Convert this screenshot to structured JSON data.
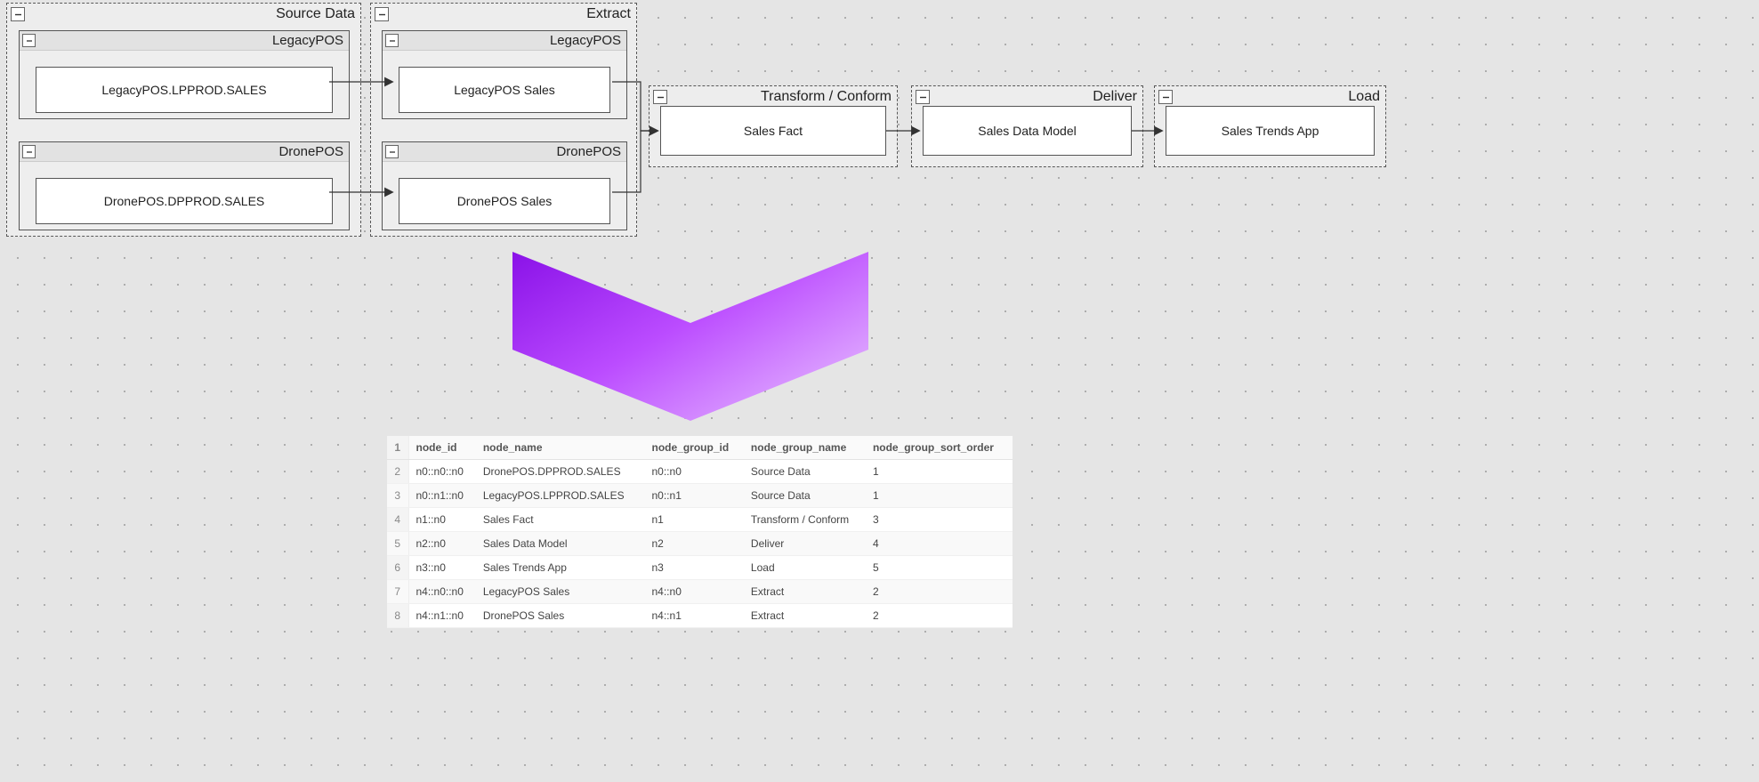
{
  "groups": {
    "source": {
      "title": "Source Data",
      "sub1": {
        "title": "LegacyPOS",
        "node": "LegacyPOS.LPPROD.SALES"
      },
      "sub2": {
        "title": "DronePOS",
        "node": "DronePOS.DPPROD.SALES"
      }
    },
    "extract": {
      "title": "Extract",
      "sub1": {
        "title": "LegacyPOS",
        "node": "LegacyPOS Sales"
      },
      "sub2": {
        "title": "DronePOS",
        "node": "DronePOS Sales"
      }
    },
    "transform": {
      "title": "Transform / Conform",
      "node": "Sales Fact"
    },
    "deliver": {
      "title": "Deliver",
      "node": "Sales Data Model"
    },
    "load": {
      "title": "Load",
      "node": "Sales Trends App"
    }
  },
  "table": {
    "headers": [
      "node_id",
      "node_name",
      "node_group_id",
      "node_group_name",
      "node_group_sort_order"
    ],
    "rows": [
      {
        "n": "1",
        "c": [
          "node_id",
          "node_name",
          "node_group_id",
          "node_group_name",
          "node_group_sort_order"
        ],
        "_h": true
      },
      {
        "n": "2",
        "c": [
          "n0::n0::n0",
          "DronePOS.DPPROD.SALES",
          "n0::n0",
          "Source Data",
          "1"
        ]
      },
      {
        "n": "3",
        "c": [
          "n0::n1::n0",
          "LegacyPOS.LPPROD.SALES",
          "n0::n1",
          "Source Data",
          "1"
        ]
      },
      {
        "n": "4",
        "c": [
          "n1::n0",
          "Sales Fact",
          "n1",
          "Transform / Conform",
          "3"
        ]
      },
      {
        "n": "5",
        "c": [
          "n2::n0",
          "Sales Data Model",
          "n2",
          "Deliver",
          "4"
        ]
      },
      {
        "n": "6",
        "c": [
          "n3::n0",
          "Sales Trends App",
          "n3",
          "Load",
          "5"
        ]
      },
      {
        "n": "7",
        "c": [
          "n4::n0::n0",
          "LegacyPOS Sales",
          "n4::n0",
          "Extract",
          "2"
        ]
      },
      {
        "n": "8",
        "c": [
          "n4::n1::n0",
          "DronePOS Sales",
          "n4::n1",
          "Extract",
          "2"
        ]
      }
    ]
  }
}
